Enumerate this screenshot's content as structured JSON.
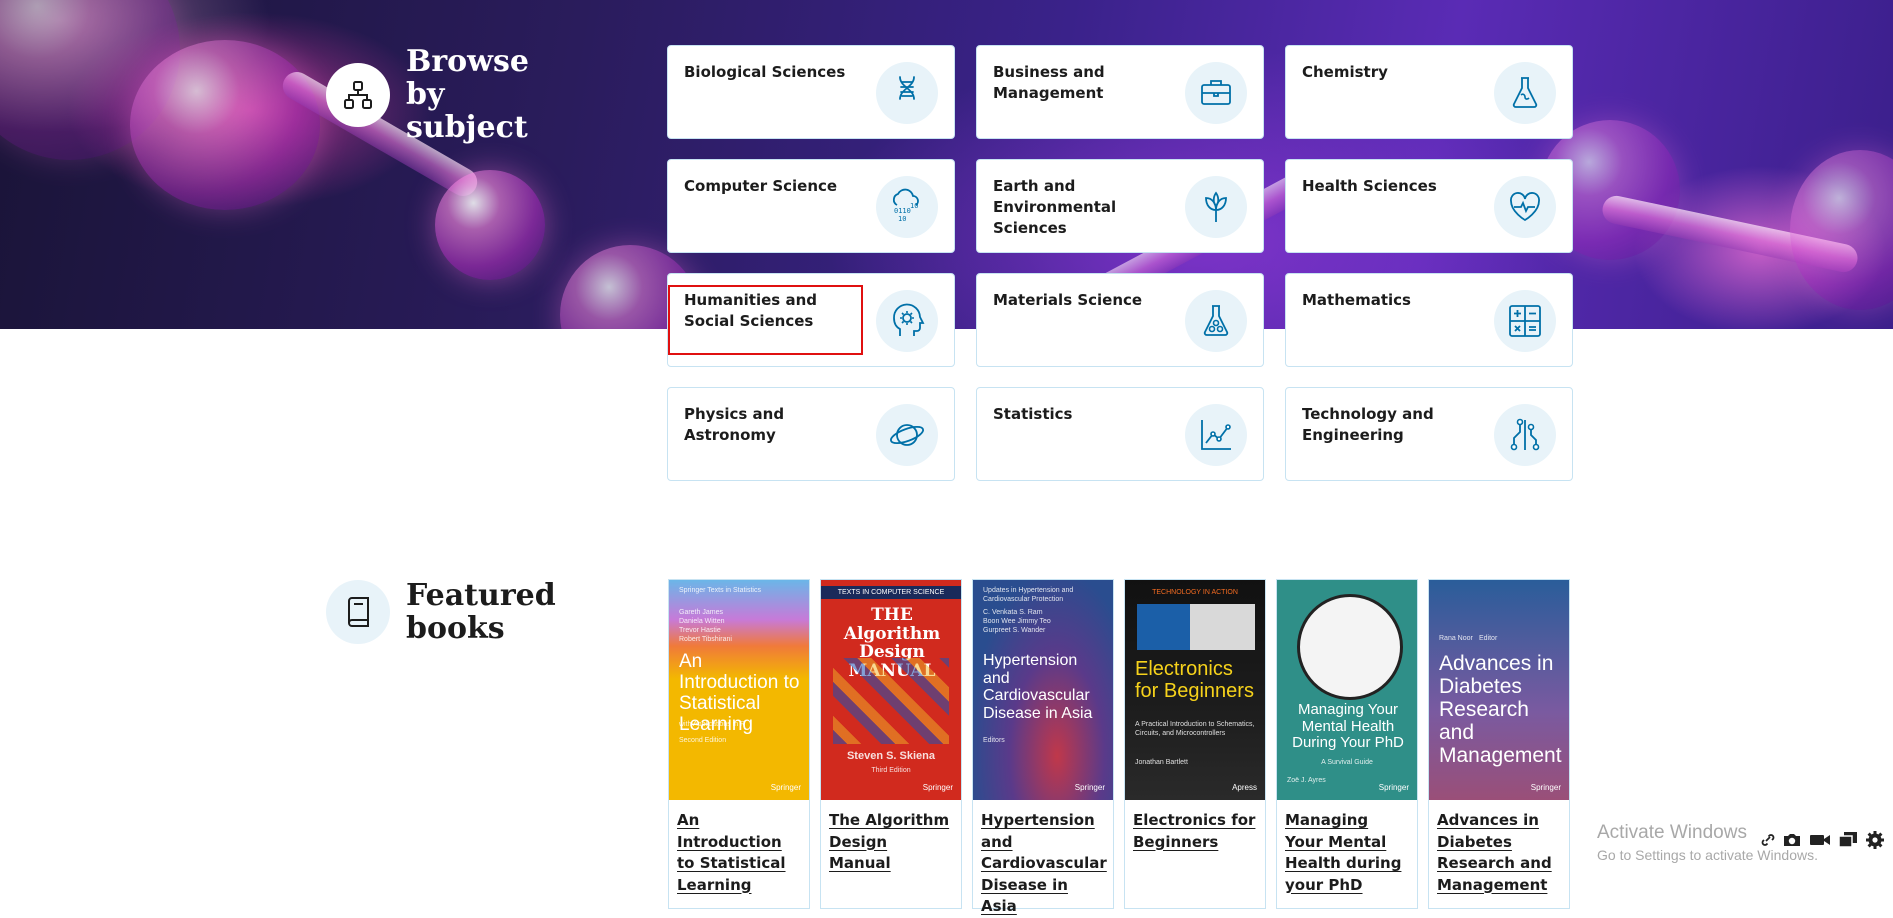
{
  "browse": {
    "title": "Browse by subject",
    "icon": "hierarchy-icon",
    "subjects": [
      {
        "label": "Biological Sciences",
        "icon": "dna-icon"
      },
      {
        "label": "Business and Management",
        "icon": "briefcase-icon"
      },
      {
        "label": "Chemistry",
        "icon": "flask-icon"
      },
      {
        "label": "Computer Science",
        "icon": "binary-cloud-icon"
      },
      {
        "label": "Earth and Environmental Sciences",
        "icon": "leaf-icon"
      },
      {
        "label": "Health Sciences",
        "icon": "heartbeat-icon"
      },
      {
        "label": "Humanities and Social Sciences",
        "icon": "head-gear-icon"
      },
      {
        "label": "Materials Science",
        "icon": "molecule-flask-icon"
      },
      {
        "label": "Mathematics",
        "icon": "math-operators-icon"
      },
      {
        "label": "Physics and Astronomy",
        "icon": "planet-icon"
      },
      {
        "label": "Statistics",
        "icon": "line-chart-icon"
      },
      {
        "label": "Technology and Engineering",
        "icon": "circuit-icon"
      }
    ]
  },
  "featured": {
    "title": "Featured books",
    "icon": "book-icon",
    "books": [
      {
        "title": "An Introduction to Statistical Learning",
        "cover_title": "An Introduction to Statistical Learning",
        "cover_subtitle": "with Applications in R",
        "cover_edition": "Second Edition",
        "cover_series": "Springer Texts in Statistics",
        "cover_authors": "Gareth James\nDaniela Witten\nTrevor Hastie\nRobert Tibshirani",
        "cover_publisher": "Springer",
        "cover_color": "#f0b400"
      },
      {
        "title": "The Algorithm Design Manual",
        "cover_title": "THE Algorithm Design MANUAL",
        "cover_series": "TEXTS IN COMPUTER SCIENCE",
        "cover_authors": "Steven S. Skiena",
        "cover_edition": "Third Edition",
        "cover_publisher": "Springer",
        "cover_color": "#d12a1e"
      },
      {
        "title": "Hypertension and Cardiovascular Disease in Asia",
        "cover_title": "Hypertension and Cardiovascular Disease in Asia",
        "cover_series": "Updates in Hypertension and Cardiovascular Protection",
        "cover_authors": "C. Venkata S. Ram\nBoon Wee Jimmy Teo\nGurpreet S. Wander",
        "cover_edition": "Editors",
        "cover_publisher": "Springer",
        "cover_color": "#2a4d8f"
      },
      {
        "title": "Electronics for Beginners",
        "cover_title": "Electronics for Beginners",
        "cover_subtitle": "A Practical Introduction to Schematics, Circuits, and Microcontrollers",
        "cover_series": "TECHNOLOGY IN ACTION",
        "cover_authors": "Jonathan Bartlett",
        "cover_publisher": "Apress",
        "cover_color": "#1c1c1c"
      },
      {
        "title": "Managing Your Mental Health during your PhD",
        "cover_title": "Managing Your Mental Health During Your PhD",
        "cover_subtitle": "A Survival Guide",
        "cover_authors": "Zoë J. Ayres",
        "cover_publisher": "Springer",
        "cover_color": "#2f8f88"
      },
      {
        "title": "Advances in Diabetes Research and Management",
        "cover_title": "Advances in Diabetes Research and Management",
        "cover_authors": "Rana Noor",
        "cover_edition": "Editor",
        "cover_publisher": "Springer",
        "cover_color": "#3a6aa6"
      }
    ]
  },
  "watermark": {
    "line1": "Activate Windows",
    "line2": "Go to Settings to activate Windows."
  },
  "toolbar": {
    "icons": [
      "link-icon",
      "camera-icon",
      "video-icon",
      "copy-icon",
      "gear-icon"
    ]
  },
  "colors": {
    "accent_icon": "#0070a8",
    "card_border": "#c7e3f2",
    "icon_bg": "#e8f3f9",
    "highlight": "#e01010"
  }
}
